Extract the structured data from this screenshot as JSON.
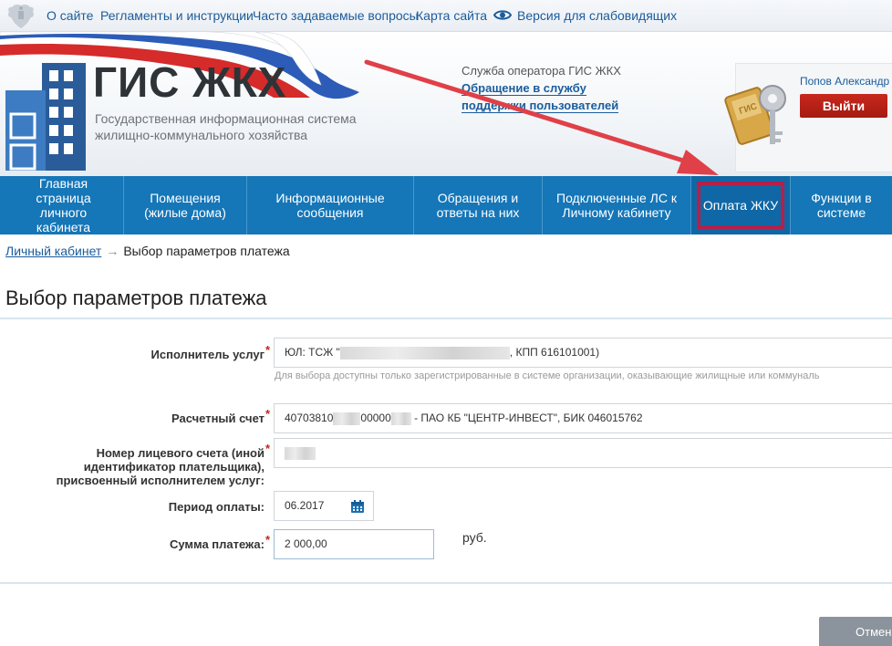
{
  "topbar": {
    "links": [
      "О сайте",
      "Регламенты и инструкции",
      "Часто задаваемые вопросы",
      "Карта сайта"
    ],
    "accessibility_label": "Версия для слабовидящих"
  },
  "header": {
    "logo_title": "ГИС ЖКХ",
    "logo_subtitle": "Государственная информационная система жилищно-коммунального хозяйства",
    "operator_label": "Служба оператора ГИС ЖКХ",
    "support_link": "Обращение в службу поддержки пользователей",
    "user_name": "Попов Александр",
    "logout_label": "Выйти"
  },
  "nav": {
    "items": [
      {
        "label": "Главная страница личного кабинета"
      },
      {
        "label": "Помещения (жилые дома)"
      },
      {
        "label": "Информационные сообщения"
      },
      {
        "label": "Обращения и ответы на них"
      },
      {
        "label": "Подключенные ЛС к Личному кабинету"
      },
      {
        "label": "Оплата ЖКУ"
      },
      {
        "label": "Функции в системе"
      }
    ],
    "active_index": 5,
    "highlight_color": "#b3214a",
    "bar_color": "#1576b8"
  },
  "breadcrumb": {
    "home": "Личный кабинет",
    "separator": "→",
    "current": "Выбор параметров платежа"
  },
  "page_title": "Выбор параметров платежа",
  "form": {
    "required_mark": "*",
    "provider": {
      "label": "Исполнитель услуг",
      "value_prefix": "ЮЛ: ТСЖ \"",
      "value_suffix": ", КПП 616101001)",
      "hint": "Для выбора доступны только зарегистрированные в системе организации, оказывающие жилищные или коммуналь"
    },
    "account": {
      "label": "Расчетный счет",
      "value_part1": "40703810",
      "value_part2": "00000",
      "value_suffix": " - ПАО КБ \"ЦЕНТР-ИНВЕСТ\", БИК 046015762"
    },
    "personal_account": {
      "label": "Номер лицевого счета (иной идентификатор плательщика), присвоенный исполнителем услуг:"
    },
    "period": {
      "label": "Период оплаты:",
      "value": "06.2017"
    },
    "amount": {
      "label": "Сумма платежа:",
      "value": "2 000,00",
      "unit": "руб."
    }
  },
  "footer": {
    "cancel_label": "Отмена"
  }
}
